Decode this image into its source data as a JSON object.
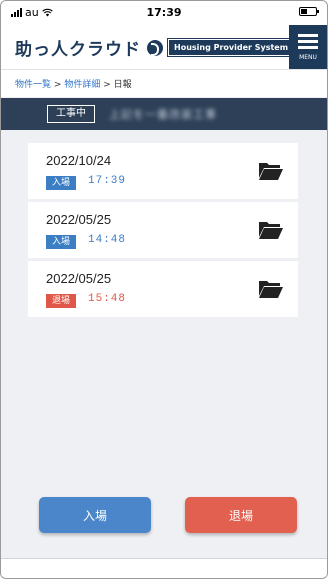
{
  "status_bar": {
    "carrier": "au",
    "time": "17:39"
  },
  "header": {
    "logo_text": "助っ人クラウド",
    "logo_tag": "Housing Provider System",
    "menu_label": "MENU"
  },
  "breadcrumb": {
    "items": [
      "物件一覧",
      "物件詳細",
      "日報"
    ],
    "separator": ">"
  },
  "project": {
    "status": "工事中",
    "name": "上記を一番改装工事"
  },
  "reports": [
    {
      "date": "2022/10/24",
      "type": "入場",
      "time": "17:39",
      "type_color": "#3b7ec4"
    },
    {
      "date": "2022/05/25",
      "type": "入場",
      "time": "14:48",
      "type_color": "#3b7ec4"
    },
    {
      "date": "2022/05/25",
      "type": "退場",
      "time": "15:48",
      "type_color": "#e0574a"
    }
  ],
  "buttons": {
    "enter": "入場",
    "exit": "退場"
  },
  "colors": {
    "navy": "#1e3a5a",
    "enter": "#4a86c9",
    "exit": "#e2604f"
  }
}
